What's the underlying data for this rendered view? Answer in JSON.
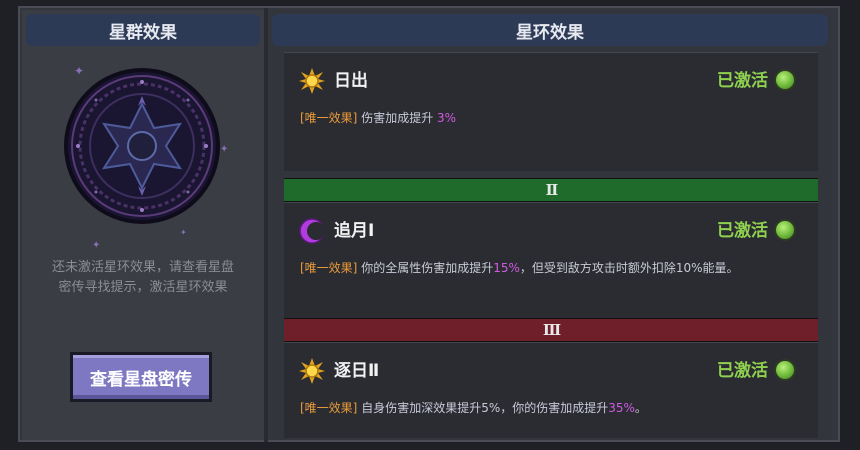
{
  "left_panel": {
    "header": "星群效果",
    "hint_line1": "还未激活星环效果，请查看星盘",
    "hint_line2": "密传寻找提示，激活星环效果",
    "button_label": "查看星盘密传"
  },
  "right_panel": {
    "header": "星环效果",
    "effects": [
      {
        "title": "日出",
        "icon": "sun-icon",
        "status": "已激活",
        "tag": "[唯一效果]",
        "desc_before": " 伤害加成提升 ",
        "desc_highlight": "3%",
        "desc_after": ""
      },
      {
        "title": "追月Ⅰ",
        "icon": "crescent-moon-icon",
        "status": "已激活",
        "tag": "[唯一效果]",
        "desc_before": " 你的全属性伤害加成提升",
        "desc_highlight": "15%",
        "desc_after": "，但受到敌方攻击时额外扣除10%能量。"
      },
      {
        "title": "逐日Ⅱ",
        "icon": "sun-icon",
        "status": "已激活",
        "tag": "[唯一效果]",
        "desc_before": " 自身伤害加深效果提升5%，你的伤害加成提升",
        "desc_highlight": "35%",
        "desc_after": "。"
      }
    ],
    "tiers": [
      "Ⅱ",
      "Ⅲ"
    ]
  },
  "colors": {
    "active": "#8fd14f",
    "tag": "#e89a3a",
    "highlight": "#d05be0",
    "tier_ii": "#1f6b2b",
    "tier_iii": "#6e1f2a"
  }
}
